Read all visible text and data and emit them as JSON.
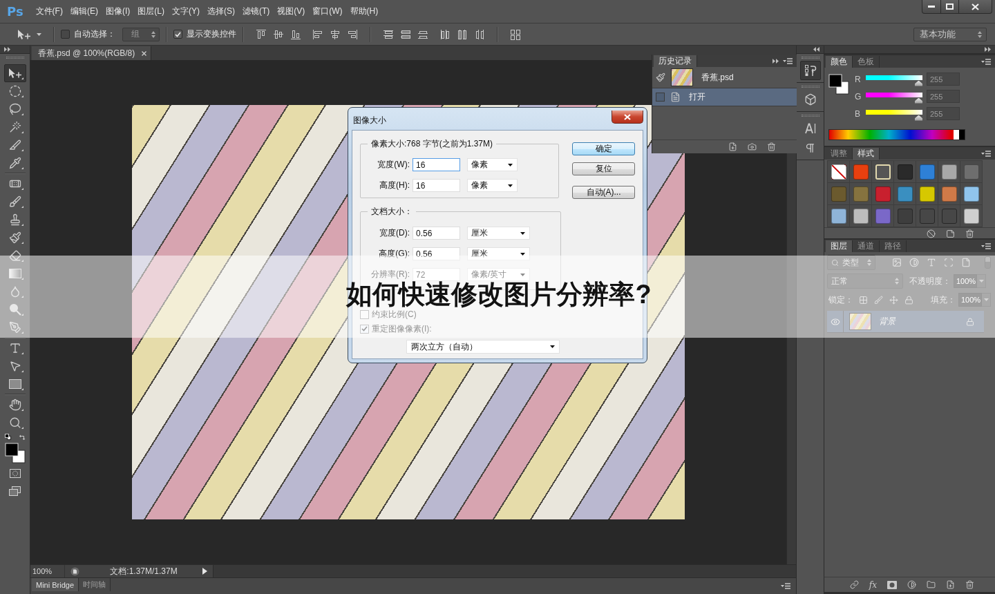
{
  "app": {
    "logo": "Ps"
  },
  "menu": [
    "文件(F)",
    "编辑(E)",
    "图像(I)",
    "图层(L)",
    "文字(Y)",
    "选择(S)",
    "滤镜(T)",
    "视图(V)",
    "窗口(W)",
    "帮助(H)"
  ],
  "options_bar": {
    "auto_select": {
      "label": "自动选择：",
      "checked": false
    },
    "auto_select_target": "组",
    "show_transform": {
      "label": "显示变换控件",
      "checked": true
    },
    "workspace": "基本功能"
  },
  "toolbox": {
    "groups": [
      [
        {
          "kind": "move",
          "selected": true
        },
        {
          "kind": "marquee",
          "selected": false
        },
        {
          "kind": "lasso",
          "selected": false
        },
        {
          "kind": "wand",
          "selected": false
        },
        {
          "kind": "crop",
          "selected": false
        },
        {
          "kind": "eyedropper",
          "selected": false
        }
      ],
      [
        {
          "kind": "healing",
          "selected": false
        },
        {
          "kind": "brush",
          "selected": false
        },
        {
          "kind": "stamp",
          "selected": false
        },
        {
          "kind": "history-brush",
          "selected": false
        },
        {
          "kind": "eraser",
          "selected": false
        },
        {
          "kind": "gradient",
          "selected": false
        },
        {
          "kind": "blur",
          "selected": false
        },
        {
          "kind": "dodge",
          "selected": false
        },
        {
          "kind": "pen",
          "selected": false
        }
      ],
      [
        {
          "kind": "type",
          "selected": false
        },
        {
          "kind": "path-select",
          "selected": false
        },
        {
          "kind": "shape",
          "selected": false
        }
      ],
      [
        {
          "kind": "hand",
          "selected": false
        },
        {
          "kind": "zoom",
          "selected": false
        }
      ]
    ]
  },
  "document": {
    "tabs": [
      {
        "title": "香蕉.psd @ 100%(RGB/8)",
        "selected": true
      }
    ],
    "zoom": "100%",
    "info": "文档:1.37M/1.37M"
  },
  "bottom_tabs": [
    {
      "label": "Mini Bridge",
      "selected": true
    },
    {
      "label": "时间轴",
      "selected": false
    }
  ],
  "history": {
    "tabs": [
      {
        "label": "历史记录",
        "selected": true
      }
    ],
    "snapshot": "香蕉.psd",
    "steps": [
      {
        "label": "打开",
        "selected": true
      }
    ]
  },
  "panel_strip": {
    "groups": [
      [
        {
          "kind": "history",
          "selected": true
        }
      ],
      [
        {
          "kind": "properties",
          "selected": false
        }
      ],
      [
        {
          "kind": "character",
          "selected": false
        },
        {
          "kind": "paragraph",
          "selected": false
        }
      ]
    ]
  },
  "color": {
    "tabs": [
      {
        "label": "颜色",
        "selected": true
      },
      {
        "label": "色板",
        "selected": false
      }
    ],
    "channels": [
      {
        "name": "R",
        "color": "#00ffff",
        "level": 1,
        "value": "255"
      },
      {
        "name": "G",
        "color": "#ff00ff",
        "level": 1,
        "value": "255"
      },
      {
        "name": "B",
        "color": "#ffff00",
        "level": 1,
        "value": "255"
      }
    ]
  },
  "styles": {
    "tabs": [
      {
        "label": "调整",
        "selected": false
      },
      {
        "label": "样式",
        "selected": true
      }
    ],
    "swatches": [
      {
        "kind": "none",
        "color": "#ffffff",
        "selected": false
      },
      {
        "kind": "fill",
        "color": "#e8400f",
        "selected": false
      },
      {
        "kind": "outline",
        "color": "#555555",
        "selected": true
      },
      {
        "kind": "fill",
        "color": "#2a2a2a",
        "selected": false
      },
      {
        "kind": "fill",
        "color": "#2e80d6",
        "selected": false
      },
      {
        "kind": "fill",
        "color": "#a8a8a8",
        "selected": false
      },
      {
        "kind": "fill",
        "color": "#6e6e6e",
        "selected": false
      },
      {
        "kind": "fill",
        "color": "#6b5a2e",
        "selected": false
      },
      {
        "kind": "fill",
        "color": "#86733f",
        "selected": false
      },
      {
        "kind": "fill",
        "color": "#c8202e",
        "selected": false
      },
      {
        "kind": "fill",
        "color": "#3a8fc0",
        "selected": false
      },
      {
        "kind": "fill",
        "color": "#d6c800",
        "selected": false
      },
      {
        "kind": "fill",
        "color": "#d07a48",
        "selected": false
      },
      {
        "kind": "fill",
        "color": "#90c4ec",
        "selected": false
      },
      {
        "kind": "fill",
        "color": "#8fb4d8",
        "selected": false
      },
      {
        "kind": "fill",
        "color": "#bdbdbd",
        "selected": false
      },
      {
        "kind": "fill",
        "color": "#7a68c8",
        "selected": false
      },
      {
        "kind": "fill",
        "color": "#3e3e3e",
        "selected": false
      },
      {
        "kind": "outline",
        "color": "#474747",
        "selected": false
      },
      {
        "kind": "outline",
        "color": "#474747",
        "selected": false
      },
      {
        "kind": "fill",
        "color": "#cfcfcf",
        "selected": false
      }
    ]
  },
  "layers": {
    "tabs": [
      {
        "label": "图层",
        "selected": true
      },
      {
        "label": "通道",
        "selected": false
      },
      {
        "label": "路径",
        "selected": false
      }
    ],
    "filter": "类型",
    "blend_mode": "正常",
    "opacity_label": "不透明度：",
    "opacity": "100%",
    "lock_label": "锁定：",
    "fill_label": "填充：",
    "fill": "100%",
    "items": [
      {
        "name": "背景",
        "visible": true,
        "locked": true,
        "selected": true
      }
    ],
    "style_button": "fx"
  },
  "dialog": {
    "title": "图像大小",
    "pixel_size": {
      "legend": "像素大小:768 字节(之前为1.37M)",
      "rows": [
        {
          "label": "宽度(W):",
          "value": "16",
          "unit": "像素",
          "focused": true
        },
        {
          "label": "高度(H):",
          "value": "16",
          "unit": "像素",
          "focused": false
        }
      ]
    },
    "document_size": {
      "legend": "文档大小：",
      "rows": [
        {
          "label": "宽度(D):",
          "value": "0.56",
          "unit": "厘米",
          "focused": false
        },
        {
          "label": "高度(G):",
          "value": "0.56",
          "unit": "厘米",
          "focused": false
        },
        {
          "label": "分辨率(R):",
          "value": "72",
          "unit": "像素/英寸",
          "focused": false
        }
      ]
    },
    "options": [
      {
        "label": "约束比例(C)",
        "checked": false
      },
      {
        "label": "重定图像像素(I):",
        "checked": true
      }
    ],
    "resample": "两次立方（自动）",
    "buttons": [
      {
        "label": "确定",
        "default": true
      },
      {
        "label": "复位",
        "default": false
      },
      {
        "label": "自动(A)...",
        "default": false
      }
    ]
  },
  "banner": {
    "title": "如何快速修改图片分辨率?"
  }
}
